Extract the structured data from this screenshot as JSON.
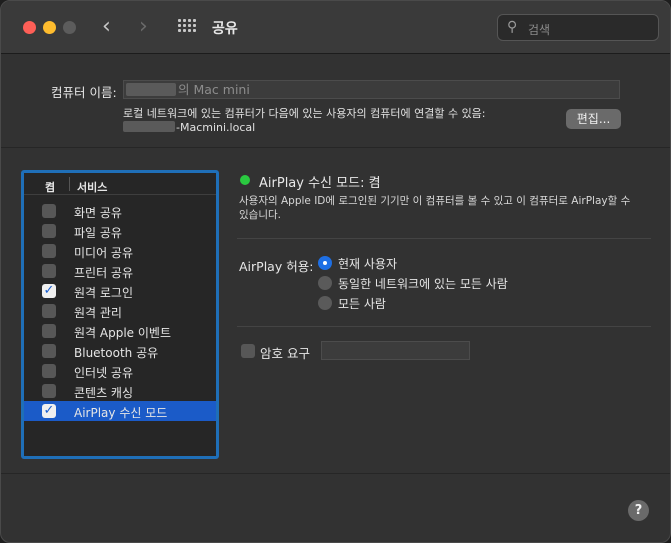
{
  "window": {
    "title": "공유",
    "search_placeholder": "검색",
    "icons": {
      "back": "chevron-left-icon",
      "forward": "chevron-right-icon",
      "grid": "grid-icon",
      "search": "magnifier-icon"
    }
  },
  "computer_name": {
    "label": "컴퓨터 이름:",
    "value_suffix": "의 Mac mini",
    "description": "로컬 네트워크에 있는 컴퓨터가 다음에 있는 사용자의 컴퓨터에 연결할 수 있음:",
    "host_suffix": "-Macmini.local",
    "edit_label": "편집..."
  },
  "services": {
    "header_on": "켬",
    "header_service": "서비스",
    "items": [
      {
        "label": "화면 공유",
        "checked": false,
        "selected": false
      },
      {
        "label": "파일 공유",
        "checked": false,
        "selected": false
      },
      {
        "label": "미디어 공유",
        "checked": false,
        "selected": false
      },
      {
        "label": "프린터 공유",
        "checked": false,
        "selected": false
      },
      {
        "label": "원격 로그인",
        "checked": true,
        "selected": false
      },
      {
        "label": "원격 관리",
        "checked": false,
        "selected": false
      },
      {
        "label": "원격 Apple 이벤트",
        "checked": false,
        "selected": false
      },
      {
        "label": "Bluetooth 공유",
        "checked": false,
        "selected": false
      },
      {
        "label": "인터넷 공유",
        "checked": false,
        "selected": false
      },
      {
        "label": "콘텐츠 캐싱",
        "checked": false,
        "selected": false
      },
      {
        "label": "AirPlay 수신 모드",
        "checked": true,
        "selected": true
      }
    ]
  },
  "detail": {
    "status": "AirPlay 수신 모드: 켬",
    "status_color": "#2ac940",
    "description": "사용자의 Apple ID에 로그인된 기기만 이 컴퓨터를 볼 수 있고 이 컴퓨터로 AirPlay할 수 있습니다.",
    "allow_label": "AirPlay 허용:",
    "options": [
      {
        "label": "현재 사용자",
        "selected": true
      },
      {
        "label": "동일한 네트워크에 있는 모든 사람",
        "selected": false
      },
      {
        "label": "모든 사람",
        "selected": false
      }
    ],
    "password_label": "암호 요구",
    "password_checked": false,
    "password_value": ""
  },
  "help_label": "?",
  "accent_color": "#1e6fe4"
}
